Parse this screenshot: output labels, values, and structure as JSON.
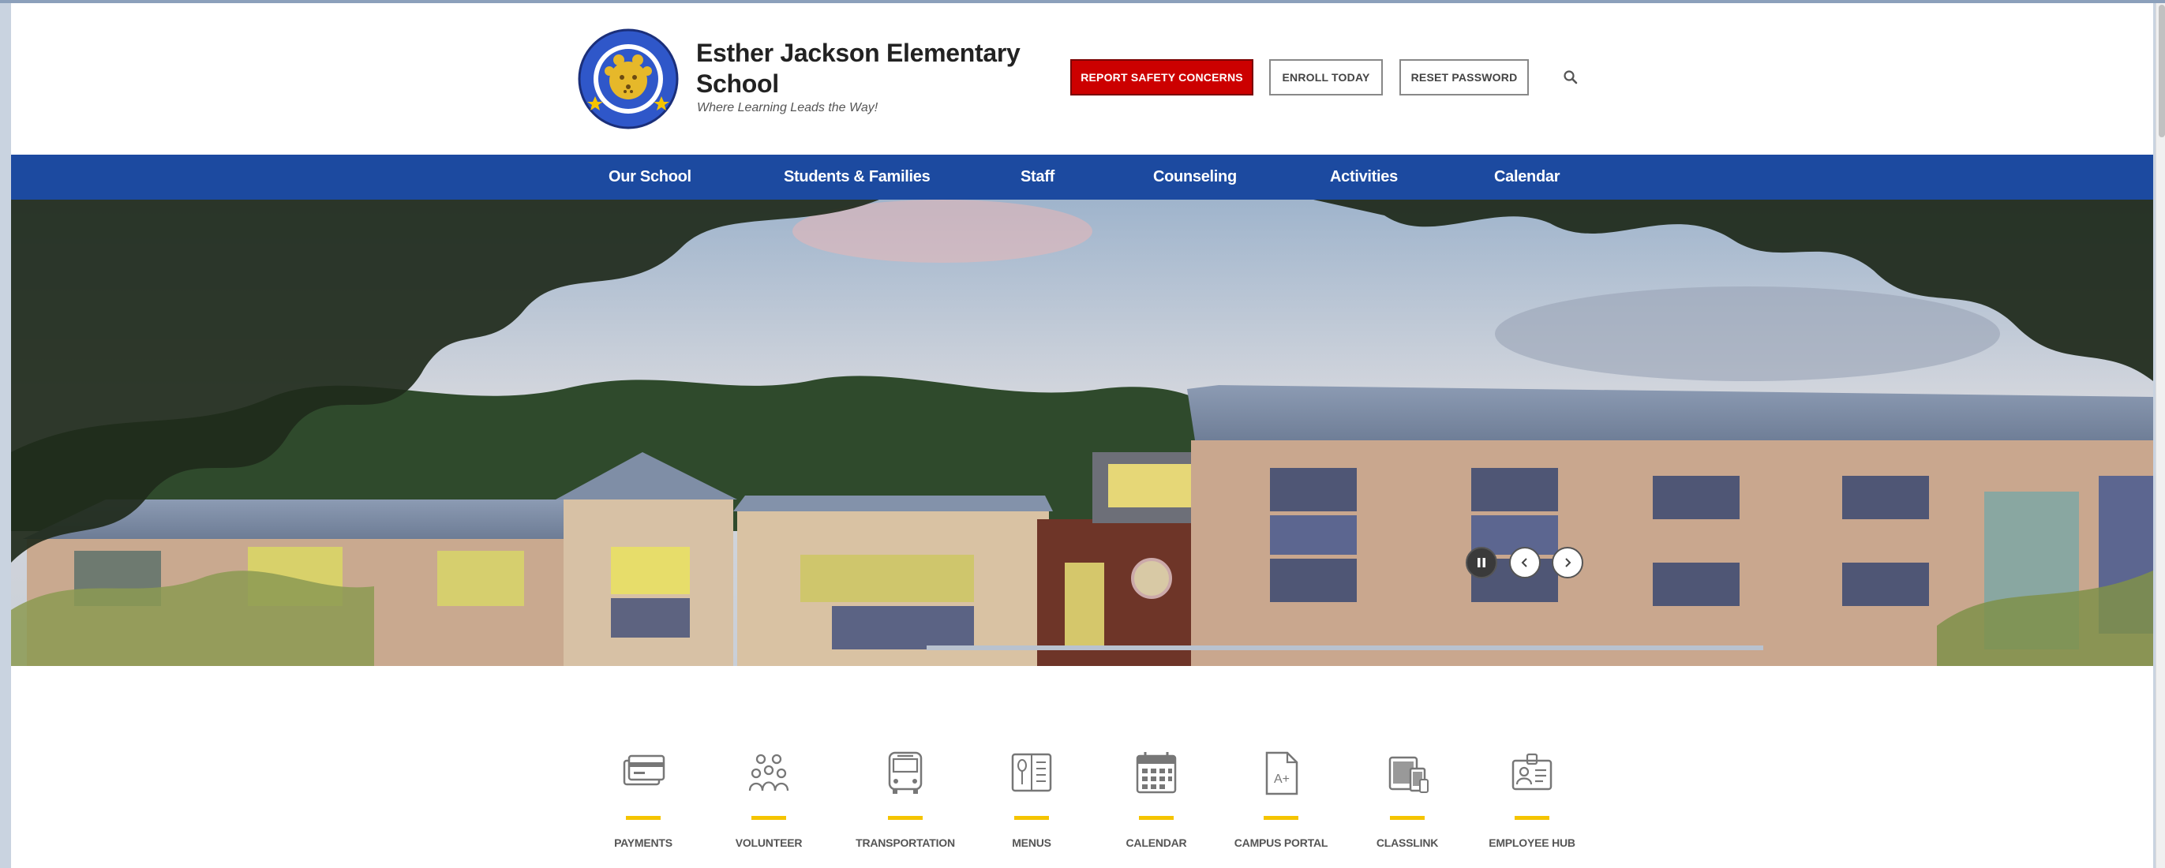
{
  "school": {
    "name": "Esther Jackson Elementary School",
    "tagline": "Where Learning Leads the Way!",
    "logo_text_top": "ESTHER JACKSON ELEMENTARY",
    "logo_text_bottom": "JAGUARS"
  },
  "header_buttons": {
    "safety": "REPORT SAFETY CONCERNS",
    "enroll": "ENROLL TODAY",
    "reset": "RESET PASSWORD"
  },
  "nav": [
    {
      "label": "Our School"
    },
    {
      "label": "Students & Families"
    },
    {
      "label": "Staff"
    },
    {
      "label": "Counseling"
    },
    {
      "label": "Activities"
    },
    {
      "label": "Calendar"
    }
  ],
  "quick_links": [
    {
      "label": "PAYMENTS",
      "icon": "credit-card-icon"
    },
    {
      "label": "VOLUNTEER",
      "icon": "people-group-icon"
    },
    {
      "label": "TRANSPORTATION",
      "icon": "bus-icon"
    },
    {
      "label": "MENUS",
      "icon": "menu-book-icon"
    },
    {
      "label": "CALENDAR",
      "icon": "calendar-icon"
    },
    {
      "label": "CAMPUS PORTAL",
      "icon": "grade-document-icon"
    },
    {
      "label": "CLASSLINK",
      "icon": "devices-icon"
    },
    {
      "label": "EMPLOYEE HUB",
      "icon": "id-badge-icon"
    }
  ],
  "colors": {
    "nav_blue": "#1c4aa0",
    "safety_red": "#cc0000",
    "accent_yellow": "#f5c400"
  }
}
